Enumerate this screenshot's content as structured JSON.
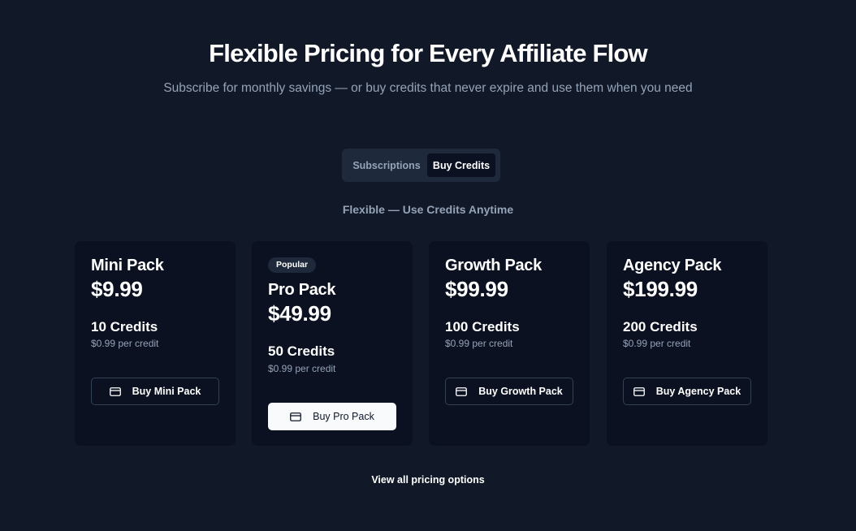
{
  "header": {
    "title": "Flexible Pricing for Every Affiliate Flow",
    "subtitle": "Subscribe for monthly savings — or buy credits that never expire and use them when you need"
  },
  "toggle": {
    "subscriptions_label": "Subscriptions",
    "buy_credits_label": "Buy Credits",
    "active": "Buy Credits"
  },
  "section_label": "Flexible — Use Credits Anytime",
  "packs": [
    {
      "name": "Mini Pack",
      "price": "$9.99",
      "credits": "10 Credits",
      "per_credit": "$0.99 per credit",
      "button_label": "Buy Mini Pack",
      "badge": ""
    },
    {
      "name": "Pro Pack",
      "price": "$49.99",
      "credits": "50 Credits",
      "per_credit": "$0.99 per credit",
      "button_label": "Buy Pro Pack",
      "badge": "Popular"
    },
    {
      "name": "Growth Pack",
      "price": "$99.99",
      "credits": "100 Credits",
      "per_credit": "$0.99 per credit",
      "button_label": "Buy Growth Pack",
      "badge": ""
    },
    {
      "name": "Agency Pack",
      "price": "$199.99",
      "credits": "200 Credits",
      "per_credit": "$0.99 per credit",
      "button_label": "Buy Agency Pack",
      "badge": ""
    }
  ],
  "button_icon": "credit-card-icon",
  "view_all_label": "View all pricing options",
  "colors": {
    "background": "#111827",
    "card": "#0b1120",
    "muted_text": "#94a3b8",
    "highlight_button": "#f8fafc"
  }
}
